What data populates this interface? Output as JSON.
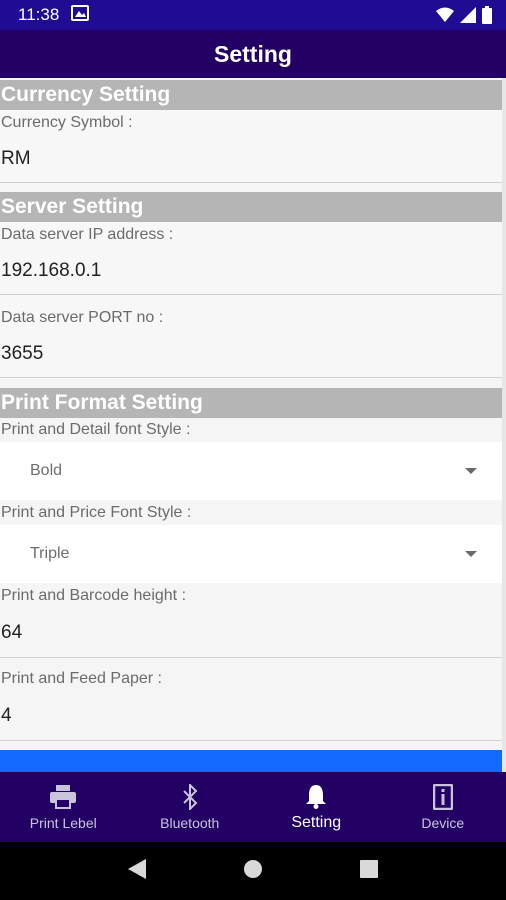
{
  "status_bar": {
    "time": "11:38"
  },
  "app_bar": {
    "title": "Setting"
  },
  "currency": {
    "header": "Currency Setting",
    "symbol_label": "Currency Symbol :",
    "symbol_value": "RM"
  },
  "server": {
    "header": "Server Setting",
    "ip_label": "Data server IP address :",
    "ip_value": "192.168.0.1",
    "port_label": "Data server PORT no :",
    "port_value": "3655"
  },
  "print_format": {
    "header": "Print Format Setting",
    "detail_font_label": "Print and Detail font Style :",
    "detail_font_value": "Bold",
    "price_font_label": "Print and Price Font Style :",
    "price_font_value": "Triple",
    "barcode_height_label": "Print and Barcode height :",
    "barcode_height_value": "64",
    "feed_paper_label": "Print and Feed Paper :",
    "feed_paper_value": "4"
  },
  "bottom_nav": {
    "items": [
      {
        "label": "Print Lebel",
        "icon": "printer-icon"
      },
      {
        "label": "Bluetooth",
        "icon": "bluetooth-icon"
      },
      {
        "label": "Setting",
        "icon": "bell-icon",
        "active": true
      },
      {
        "label": "Device",
        "icon": "info-icon"
      }
    ]
  },
  "colors": {
    "app_bar": "#220064",
    "status_bar": "#1f0c92",
    "section_header": "#b5b5b5",
    "accent_blue": "#1469ff"
  }
}
